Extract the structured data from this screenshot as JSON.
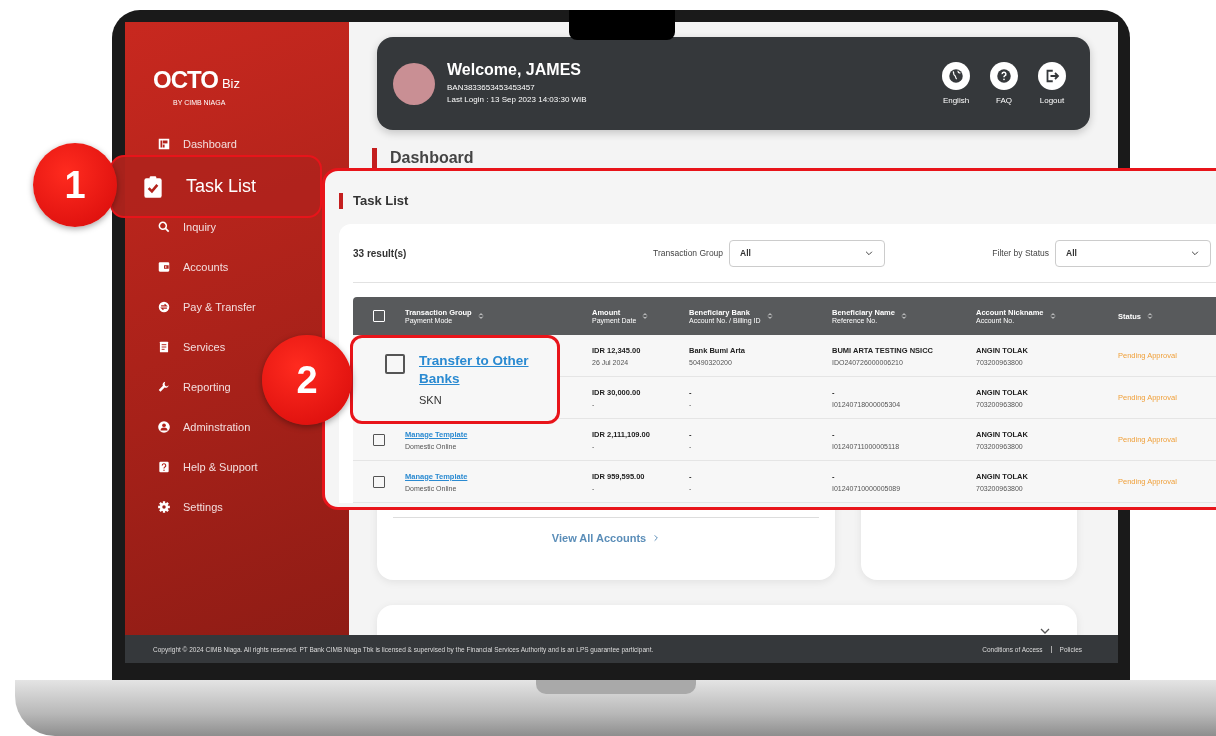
{
  "sidebar": {
    "logo": {
      "brand": "OCTO",
      "suffix": "Biz",
      "byline": "BY CIMB NIAGA"
    },
    "items": [
      {
        "label": "Dashboard",
        "kind": "link"
      },
      {
        "label": "Task List",
        "kind": "highlight",
        "number": "1"
      },
      {
        "label": "Inquiry",
        "kind": "link"
      },
      {
        "label": "Accounts",
        "kind": "link"
      },
      {
        "label": "Pay & Transfer",
        "kind": "link"
      },
      {
        "label": "Services",
        "kind": "link"
      },
      {
        "label": "Reporting",
        "kind": "link"
      },
      {
        "label": "Adminstration",
        "kind": "link"
      },
      {
        "label": "Help & Support",
        "kind": "link"
      },
      {
        "label": "Settings",
        "kind": "link"
      }
    ]
  },
  "header": {
    "welcome": "Welcome, JAMES",
    "user_id": "BAN3833653453453457",
    "last_login": "Last Login : 13 Sep 2023 14:03:30 WIB",
    "actions": [
      {
        "label": "English"
      },
      {
        "label": "FAQ"
      },
      {
        "label": "Logout"
      }
    ]
  },
  "page_title": "Dashboard",
  "accounts_card": {
    "link": "View All Accounts"
  },
  "footer": {
    "copyright": "Copyright © 2024 CIMB Niaga. All rights reserved. PT Bank CIMB Niaga Tbk is licensed & supervised by the Financial Services Authority and is an LPS guarantee participant.",
    "links": [
      "Conditions of Access",
      "Policies"
    ]
  },
  "task_list": {
    "title": "Task List",
    "result_count": "33 result(s)",
    "select_all_checked": false,
    "filters": [
      {
        "label": "Transaction Group",
        "value": "All"
      },
      {
        "label": "Filter by Status",
        "value": "All"
      }
    ],
    "columns": [
      {
        "title": "Transaction Group",
        "subtitle": "Payment Mode"
      },
      {
        "title": "Amount",
        "subtitle": "Payment Date"
      },
      {
        "title": "Beneficiary Bank",
        "subtitle": "Account No. / Billing ID"
      },
      {
        "title": "Beneficiary Name",
        "subtitle": "Reference No."
      },
      {
        "title": "Account Nickname",
        "subtitle": "Account No."
      },
      {
        "title": "Status"
      }
    ],
    "rows": [
      {
        "amount": "IDR 12,345.00",
        "date": "26 Jul 2024",
        "bank": "Bank Bumi Arta",
        "bank_account": "50490320200",
        "name": "BUMI ARTA TESTING NSICC",
        "reference": "IDO240726000006210",
        "nickname": "ANGIN TOLAK",
        "account": "703200963800",
        "status": "Pending Approval"
      },
      {
        "amount": "IDR 30,000.00",
        "date": "-",
        "bank": "-",
        "bank_account": "-",
        "name": "-",
        "reference": "I01240718000005304",
        "nickname": "ANGIN TOLAK",
        "account": "703200963800",
        "status": "Pending Approval"
      },
      {
        "checked": false,
        "transaction_group": "Manage Template",
        "payment_mode": "Domestic Online",
        "amount": "IDR 2,111,109.00",
        "date": "-",
        "bank": "-",
        "bank_account": "-",
        "name": "-",
        "reference": "I01240711000005118",
        "nickname": "ANGIN TOLAK",
        "account": "703200963800",
        "status": "Pending Approval"
      },
      {
        "checked": false,
        "transaction_group": "Manage Template",
        "payment_mode": "Domestic Online",
        "amount": "IDR 959,595.00",
        "date": "-",
        "bank": "-",
        "bank_account": "-",
        "name": "-",
        "reference": "I01240710000005089",
        "nickname": "ANGIN TOLAK",
        "account": "703200963800",
        "status": "Pending Approval"
      }
    ],
    "callout": {
      "number": "2",
      "checked": false,
      "link": "Transfer to Other Banks",
      "subtext": "SKN"
    }
  }
}
